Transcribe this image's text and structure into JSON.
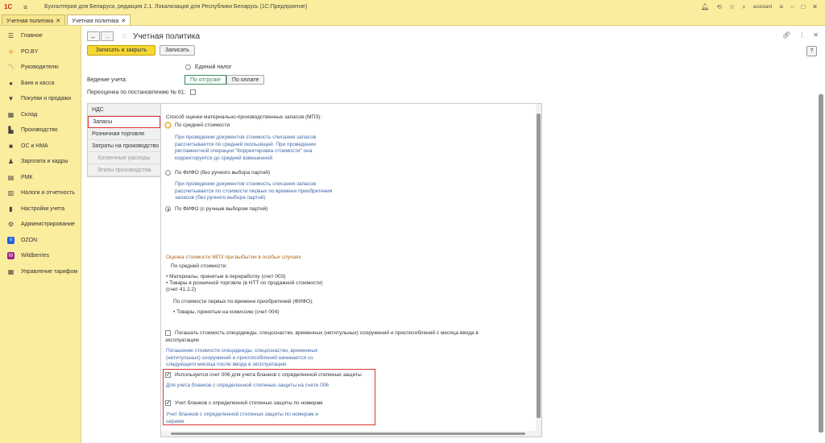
{
  "titlebar": {
    "logo": "1С",
    "app_title": "Бухгалтерия для Беларуси, редакция 2.1. Локализация для Республики Беларусь",
    "app_platform": "(1С:Предприятие)",
    "user": "assistant"
  },
  "tabs": [
    {
      "label": "Учетная политика",
      "active": false
    },
    {
      "label": "Учетная политика",
      "active": true
    }
  ],
  "sidebar": {
    "items": [
      {
        "label": "Главное",
        "icon": "menu-icon"
      },
      {
        "label": "PO.BY",
        "icon": "sun-icon"
      },
      {
        "label": "Руководителю",
        "icon": "chart-icon"
      },
      {
        "label": "Банк и касса",
        "icon": "bank-icon"
      },
      {
        "label": "Покупки и продажи",
        "icon": "cart-icon"
      },
      {
        "label": "Склад",
        "icon": "warehouse-icon"
      },
      {
        "label": "Производство",
        "icon": "factory-icon"
      },
      {
        "label": "ОС и НМА",
        "icon": "truck-icon"
      },
      {
        "label": "Зарплата и кадры",
        "icon": "person-icon"
      },
      {
        "label": "РМК",
        "icon": "register-icon"
      },
      {
        "label": "Налоги и отчетность",
        "icon": "report-icon"
      },
      {
        "label": "Настройки учета",
        "icon": "book-icon"
      },
      {
        "label": "Администрирование",
        "icon": "gear-icon"
      },
      {
        "label": "OZON",
        "icon": "ozon-icon"
      },
      {
        "label": "Wildberries",
        "icon": "wildberries-icon"
      },
      {
        "label": "Управление тарифом",
        "icon": "grid-icon"
      }
    ]
  },
  "header": {
    "title": "Учетная политика",
    "save_close": "Записать и закрыть",
    "save": "Записать",
    "help": "?"
  },
  "form": {
    "single_tax": "Единый налог",
    "accounting_label": "Ведение учета:",
    "toggle_options": [
      "По отгрузке",
      "По оплате"
    ],
    "revaluation_label": "Переоценка по постановлению № 61:"
  },
  "sections": [
    {
      "label": "НДС",
      "state": "normal"
    },
    {
      "label": "Запасы",
      "state": "selected"
    },
    {
      "label": "Розничная торговля",
      "state": "normal"
    },
    {
      "label": "Затраты на производство",
      "state": "normal"
    },
    {
      "label": "Косвенные расходы",
      "state": "disabled"
    },
    {
      "label": "Этапы производства",
      "state": "disabled"
    }
  ],
  "content": {
    "method_label": "Способ оценки материально-производственных запасов (МПЗ):",
    "opt1": "По средней стоимости",
    "opt1_desc": "При проведении документов стоимость списания запасов рассчитывается по средней скользящей. При проведении регламентной операции \"Корректировка стоимости\" она корректируется до средней взвешенной",
    "opt2": "По ФИФО (без ручного выбора партий)",
    "opt2_desc": "При проведении документов стоимость списания запасов рассчитывается по стоимости первых по времени приобретения запасов (без ручного выбора партий)",
    "opt3": "По ФИФО (с ручным выбором партий)",
    "special_title": "Оценка стоимости МПЗ при выбытии в  особых случаях",
    "avg_cost": "По средней стоимости:",
    "materials": "• Материалы, принятые в переработку (счет 003)",
    "goods": "• Товары в розничной торговле (в НТТ по продажной стоимости)",
    "goods_acc": "(счет 41.2.2)",
    "fifo_cost": "По стоимости первых по времени приобретений (ФИФО):",
    "commission": "• Товары, принятые на комиссию (счет 004)",
    "workwear": "Погашать стоимость спецодежды, спецоснастки,  временных (нетитульных) сооружений и приспособлений с месяца ввода в эксплуатацию",
    "workwear_desc": "Погашение стоимости спецодежды, спецоснастки, временных (нетитульных) сооружений и приспособлений начинается со следующего месяца после ввода в эксплуатацию",
    "acc006": "Используется счет 006 для учета бланков с определенной степенью защиты",
    "acc006_desc": "Для учета бланков с определенной степенью защиты на счете 006",
    "numbers": "Учет бланков с определенной степенью защиты по номерам",
    "numbers_desc": "Учет бланков с определенной степенью защиты по номерам и сериям"
  }
}
